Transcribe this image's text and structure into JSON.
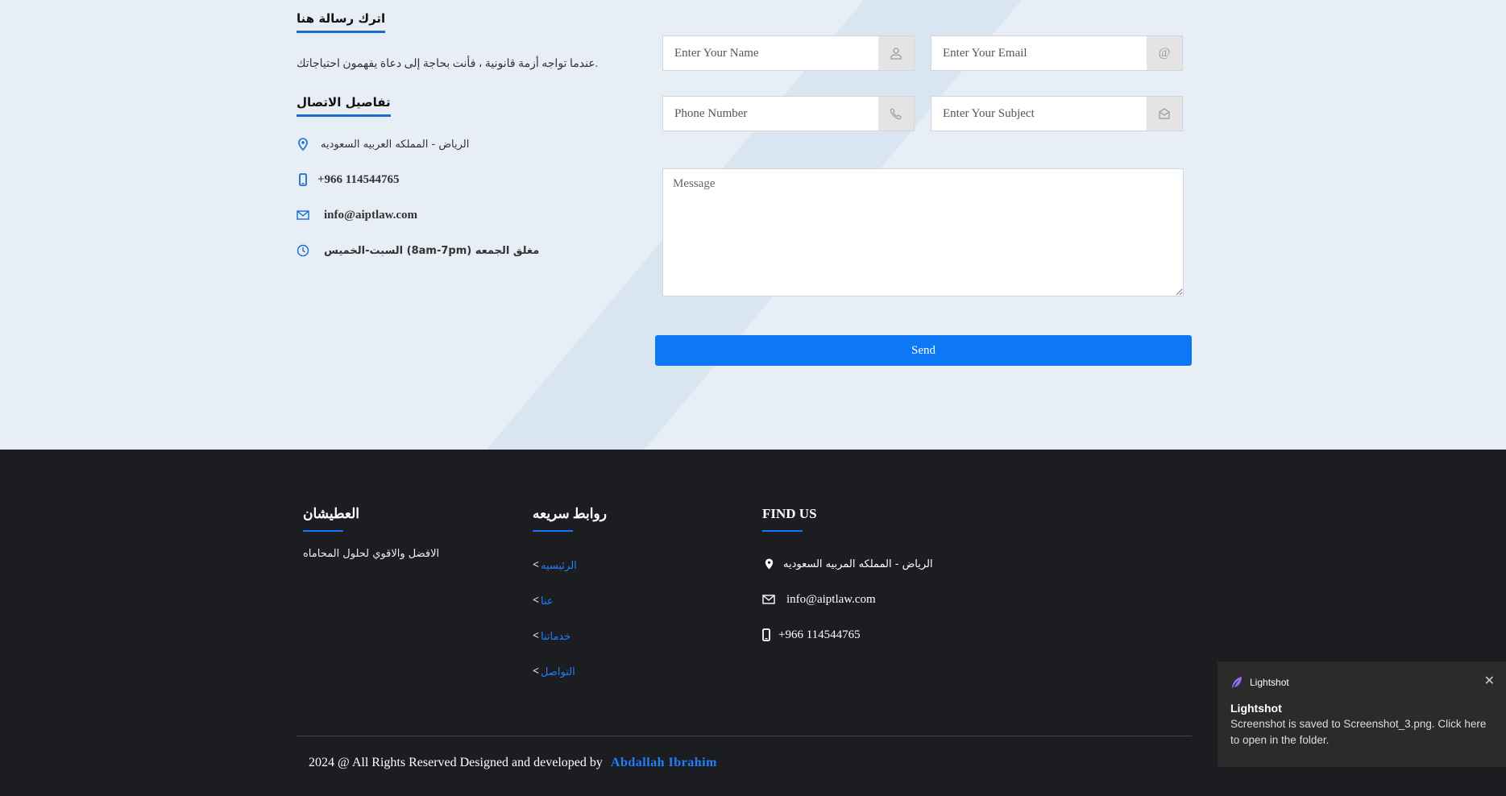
{
  "contact": {
    "message_heading": "اترك رسالة هنا",
    "intro": "عندما تواجه أزمة قانونية ، فأنت بحاجة إلى دعاة يفهمون احتياجاتك.",
    "details_heading": "تفاصيل الاتصال",
    "address": "الرياض - المملكه العربيه السعوديه",
    "phone": "+966 114544765",
    "email": "info@aiptlaw.com",
    "hours": "السبت-الخميس (8am-7pm) مغلق الجمعه"
  },
  "form": {
    "name_placeholder": "Enter Your Name",
    "email_placeholder": "Enter Your Email",
    "phone_placeholder": "Phone Number",
    "subject_placeholder": "Enter Your Subject",
    "message_placeholder": "Message",
    "send_label": "Send",
    "email_addon": "@"
  },
  "footer": {
    "about_heading": "العطيشان",
    "about_text": "الافضل والاقوي لحلول المحاماه",
    "links_heading": "روابط سريعه",
    "links": [
      {
        "label": "الرئيسيه"
      },
      {
        "label": "عنا"
      },
      {
        "label": "خدماتنا"
      },
      {
        "label": "التواصل"
      }
    ],
    "find_heading": "FIND US",
    "address": "الرياض - المملكه المربيه السعوديه",
    "email": "info@aiptlaw.com",
    "phone": "+966 114544765",
    "copyright": "2024 @ All Rights Reserved Designed and developed by",
    "author": "Abdallah Ibrahim"
  },
  "toast": {
    "app": "Lightshot",
    "title": "Lightshot",
    "message": "Screenshot is saved to Screenshot_3.png. Click here to open in the folder."
  },
  "colors": {
    "accent": "#0d78f5",
    "footer_bg": "#1c1d20",
    "section_bg": "#e7eef6"
  }
}
